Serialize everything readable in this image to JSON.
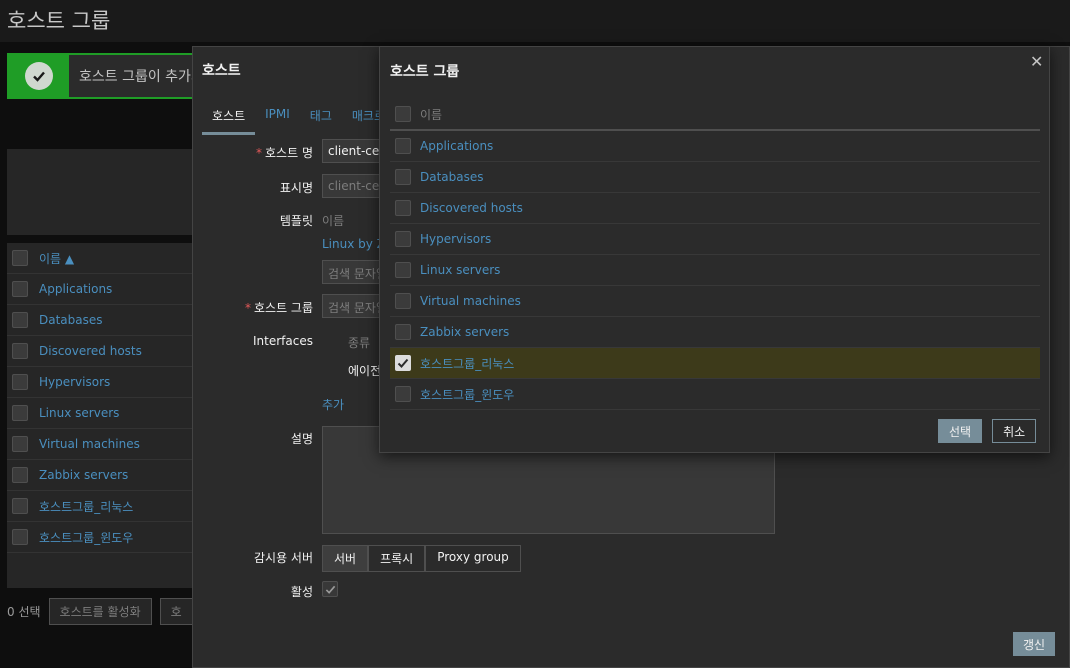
{
  "page": {
    "title": "호스트 그룹"
  },
  "message": {
    "text": "호스트 그룹이 추가되",
    "color": "#1f9d26"
  },
  "bg_table": {
    "header": "이름 ▲",
    "rows": [
      "Applications",
      "Databases",
      "Discovered hosts",
      "Hypervisors",
      "Linux servers",
      "Virtual machines",
      "Zabbix servers",
      "호스트그룹_리눅스",
      "호스트그룹_윈도우"
    ]
  },
  "bg_footer": {
    "selected": "0 선택",
    "enable_btn": "호스트를 활성화",
    "other_btn": "호"
  },
  "host_dialog": {
    "title": "호스트",
    "tabs": [
      "호스트",
      "IPMI",
      "태그",
      "매크로"
    ],
    "labels": {
      "host_name": "호스트 명",
      "visible_name": "표시명",
      "templates": "템플릿",
      "host_groups": "호스트 그룹",
      "interfaces": "Interfaces",
      "description": "설명",
      "monitored_by": "감시용 서버",
      "enabled": "활성"
    },
    "host_name_value": "client-cen",
    "visible_name_placeholder": "client-cen",
    "templates_col": "이름",
    "template_link": "Linux by Z",
    "template_search_placeholder": "검색 문자열",
    "group_search_placeholder": "검색 문자열",
    "interfaces_col": "종류",
    "interface_agent": "에이전",
    "add_link": "추가",
    "monitor_options": [
      "서버",
      "프록시",
      "Proxy group"
    ],
    "update_btn": "갱신"
  },
  "popup": {
    "title": "호스트 그룹",
    "header": "이름",
    "rows": [
      {
        "name": "Applications",
        "checked": false
      },
      {
        "name": "Databases",
        "checked": false
      },
      {
        "name": "Discovered hosts",
        "checked": false
      },
      {
        "name": "Hypervisors",
        "checked": false
      },
      {
        "name": "Linux servers",
        "checked": false
      },
      {
        "name": "Virtual machines",
        "checked": false
      },
      {
        "name": "Zabbix servers",
        "checked": false
      },
      {
        "name": "호스트그룹_리눅스",
        "checked": true
      },
      {
        "name": "호스트그룹_윈도우",
        "checked": false
      }
    ],
    "select_btn": "선택",
    "cancel_btn": "취소"
  },
  "colors": {
    "accent": "#768d99",
    "link": "#4a8fbf",
    "required": "#e45959",
    "selected_row": "#3d3a1a"
  },
  "icons": {
    "success": "check-circle-icon",
    "close": "close-icon",
    "sort": "sort-asc-icon",
    "check": "checkmark-icon"
  }
}
